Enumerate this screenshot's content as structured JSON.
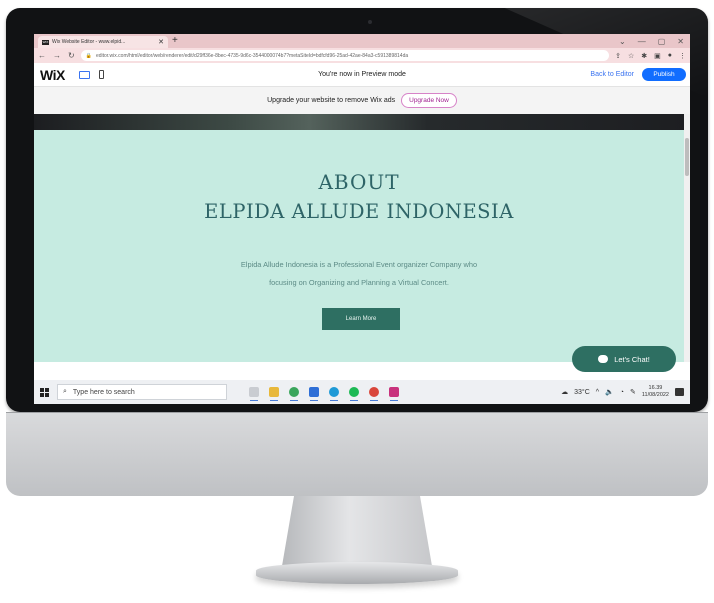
{
  "browser": {
    "tab_title": "Wix Website Editor - www.elpid...",
    "tab_favicon": "WIX",
    "new_tab": "+",
    "url": "editor.wix.com/html/editor/web/renderer/edit/d29ff36e-8bec-4735-9d6c-3544000074b7?metaSiteId=bdfcfd96-25ad-42ae-84a3-c591389814da",
    "window_controls": [
      "⌄",
      "—",
      "▢",
      "✕"
    ]
  },
  "wix": {
    "logo": "WiX",
    "preview_text": "You're now in Preview mode",
    "back_to_editor": "Back to Editor",
    "publish": "Publish"
  },
  "ads": {
    "text": "Upgrade your website to remove Wix ads",
    "button": "Upgrade Now"
  },
  "page": {
    "heading": "ABOUT",
    "company": "ELPIDA ALLUDE INDONESIA",
    "description_line1": "Elpida Allude Indonesia is a Professional Event organizer Company who",
    "description_line2": "focusing on Organizing and Planning a Virtual Concert.",
    "learn_more": "Learn More",
    "chat": "Let's Chat!"
  },
  "taskbar": {
    "search_placeholder": "Type here to search",
    "temperature": "33°C",
    "time": "16.39",
    "date": "11/08/2022"
  },
  "colors": {
    "mint_background": "#c6ebe1",
    "teal_heading": "#2e6467",
    "teal_button": "#2e6f62",
    "wix_blue": "#116dff",
    "tab_pink": "#e9c6c9"
  }
}
